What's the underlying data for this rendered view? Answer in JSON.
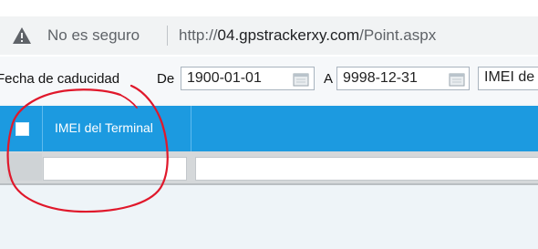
{
  "browser": {
    "security_label": "No es seguro",
    "url_scheme": "http://",
    "url_host": "04.gpstrackerxy.com",
    "url_path": "/Point.aspx"
  },
  "filters": {
    "expiry_label": "Fecha de caducidad",
    "from_label": "De",
    "from_value": "1900-01-01",
    "to_label": "A",
    "to_value": "9998-12-31",
    "imei_select_value": "IMEI de"
  },
  "grid": {
    "columns": [
      "IMEI del Terminal"
    ]
  },
  "colors": {
    "header_blue": "#1c9ae0",
    "annotation_red": "#e0182b"
  }
}
